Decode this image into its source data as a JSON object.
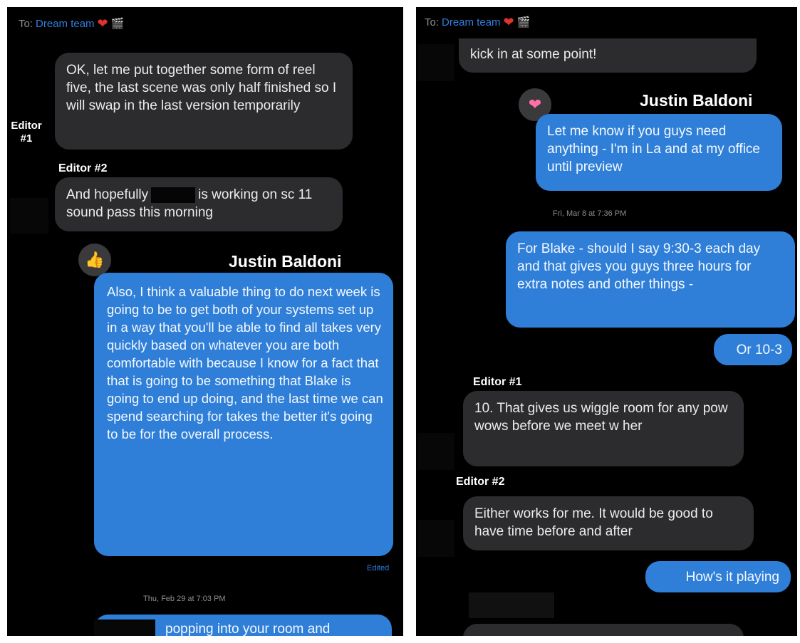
{
  "left": {
    "to_prefix": "To:",
    "to_name": "Dream team",
    "msg_reel": "OK, let me put together some form of reel five, the last scene was only half finished so I will swap in the last version temporarily",
    "label_editor1": "Editor\n#1",
    "label_editor2": "Editor #2",
    "msg_sound_a": "And hopefully",
    "msg_sound_b": "is working on sc 11 sound pass this morning",
    "speaker_justin": "Justin Baldoni",
    "msg_systems": "Also, I think a valuable thing to do next week is going to be to get both of your systems set up in a way that you'll be able to find all takes very quickly based on whatever you are both comfortable with because I know for a fact that that is going to be something that Blake is going to end up doing, and the last time we can spend searching for takes the better it's going to be for the overall process.",
    "edited_label": "Edited",
    "timestamp": "Thu, Feb 29 at 7:03 PM",
    "msg_popping": "popping into your room and"
  },
  "right": {
    "to_prefix": "To:",
    "to_name": "Dream team",
    "msg_kick": "kick in at some point!",
    "speaker_justin": "Justin Baldoni",
    "msg_letmeknow": "Let me know if you guys need anything - I'm in La and at my office until preview",
    "timestamp": "Fri, Mar 8 at 7:36 PM",
    "msg_blake": "For Blake - should I say 9:30-3 each day and that gives you guys three hours for extra notes and other things -",
    "msg_or": "Or 10-3",
    "label_editor1": "Editor #1",
    "msg_wiggle": "10. That gives us wiggle room for any pow wows before we meet w her",
    "label_editor2": "Editor #2",
    "msg_either": "Either works for me. It would be good to have time before and after",
    "msg_playing": "How's it playing"
  },
  "colors": {
    "bubble_blue": "#2f7fd8",
    "bubble_gray": "#2c2c2e",
    "background": "#000000",
    "link_blue": "#2f7fe0"
  },
  "icons": [
    "heart-icon",
    "clapperboard-icon",
    "thumbs-up-icon",
    "pink-heart-icon"
  ]
}
